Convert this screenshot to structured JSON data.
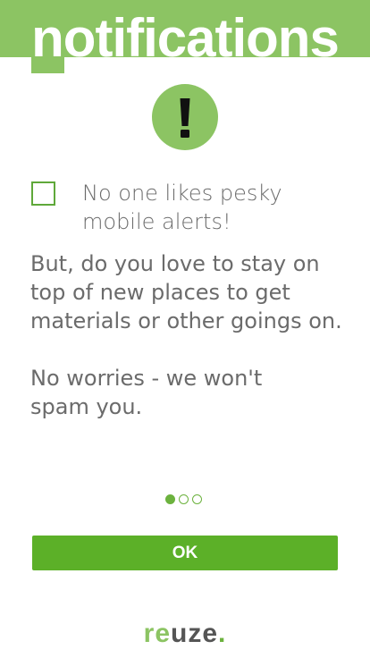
{
  "header": {
    "title": "notifications"
  },
  "alert": {
    "icon": "exclamation-icon"
  },
  "optin": {
    "checked": false,
    "label": "No one likes pesky mobile alerts!"
  },
  "body": {
    "paragraph1": "But, do you love to stay on top of new places to get materials or other goings on.",
    "paragraph2": "No worries - we won't spam you."
  },
  "pagination": {
    "current": 1,
    "total": 3
  },
  "actions": {
    "ok_label": "OK"
  },
  "brand": {
    "logo_part1": "re",
    "logo_part2": "uze",
    "logo_part3": "."
  },
  "colors": {
    "accent": "#8cc463",
    "button": "#5cb028",
    "text": "#6b6b6b"
  }
}
